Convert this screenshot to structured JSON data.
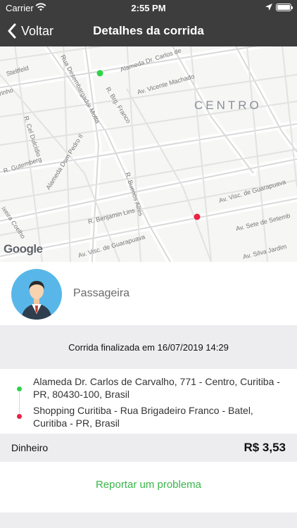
{
  "status_bar": {
    "carrier": "Carrier",
    "time": "2:55 PM",
    "icons": [
      "wifi-icon",
      "location-arrow-icon",
      "battery-icon"
    ]
  },
  "nav": {
    "back_label": "Voltar",
    "title": "Detalhes da corrida"
  },
  "map": {
    "district_label": "CENTRO",
    "attribution": "Google",
    "street_labels": [
      "Alameda Dr. Carlos de",
      "Av. Vicente Machado",
      "Rua Desembargador Motta",
      "R. Brg. Franco",
      "R. Cel Dulcídio",
      "Alameda Dom Pedro II",
      "R. Gutemberg",
      "R. Buenos Aires",
      "R. Benjamin Lins",
      "Av. Visc. de Guarapuava",
      "Av. Sete de Setemb",
      "Av. Silva Jardim",
      "Av. Visc. de Guarapuava",
      "ixeira Coelho",
      "Steltfeld",
      "rinho"
    ],
    "origin_color": "#2bd44a",
    "destination_color": "#ec2143"
  },
  "passenger": {
    "avatar_icon": "avatar-icon",
    "name": "Passageira"
  },
  "ride_status": "Corrida finalizada em 16/07/2019 14:29",
  "route": {
    "origin": "Alameda Dr. Carlos de Carvalho, 771 - Centro, Curitiba - PR, 80430-100, Brasil",
    "destination": "Shopping Curitiba - Rua Brigadeiro Franco - Batel, Curitiba - PR, Brasil"
  },
  "payment": {
    "method": "Dinheiro",
    "amount": "R$ 3,53"
  },
  "report_label": "Reportar um problema",
  "colors": {
    "header": "#3d3d3d",
    "accent_green": "#39b54a",
    "avatar_bg": "#58b7e8"
  }
}
